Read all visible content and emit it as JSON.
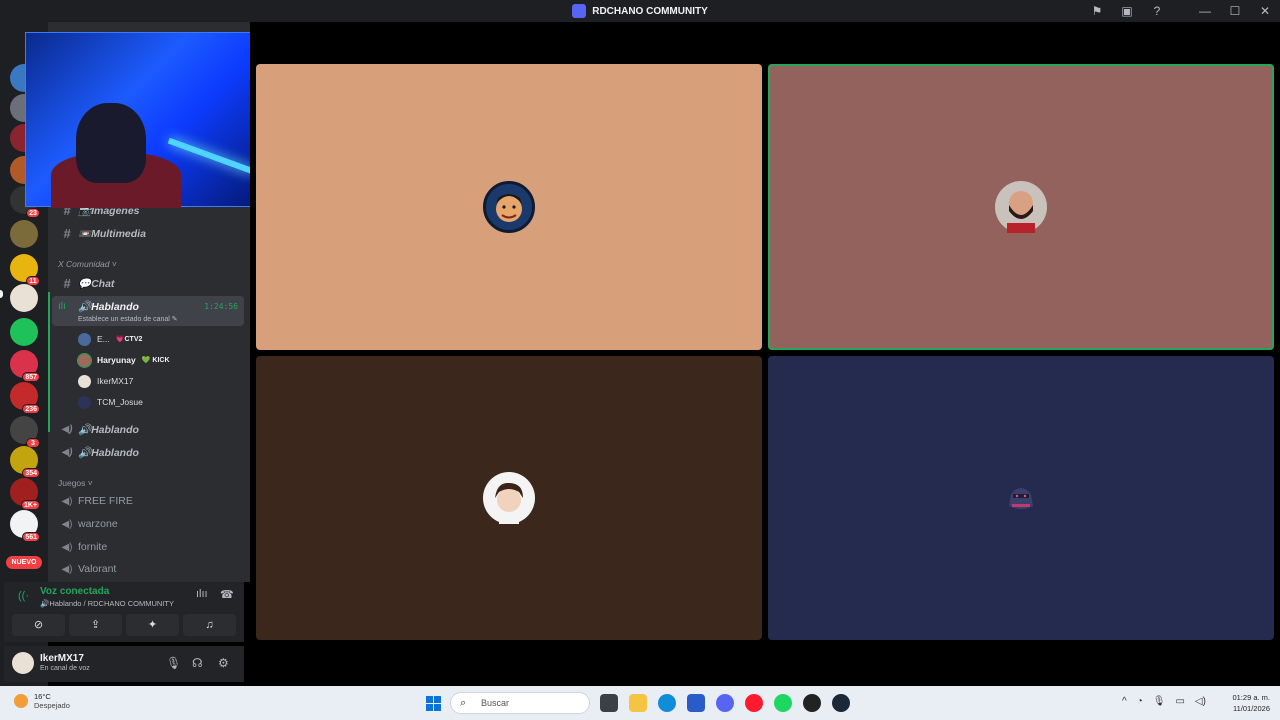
{
  "window": {
    "title": "RDCHANO COMMUNITY",
    "controls": [
      "flag",
      "inbox",
      "help",
      "minimize",
      "maximize",
      "close"
    ]
  },
  "guild_badges": [
    "23",
    "11",
    "857",
    "236",
    "3",
    "354",
    "1K+",
    "561"
  ],
  "guild_new_label": "NUEVO",
  "channels": {
    "images": "📷Imagenes",
    "multimedia": "📼Multimedia",
    "category_community": "X Comunidad ˅",
    "chat": "💬Chat",
    "active_voice": {
      "name": "🔊Hablando",
      "status": "Establece un estado de canal ✎",
      "timer": "1:24:56",
      "members": [
        {
          "name": "E...",
          "tag": "💗CTV2"
        },
        {
          "name": "Haryunay",
          "tag": "💚 KICK"
        },
        {
          "name": "IkerMX17",
          "tag": ""
        },
        {
          "name": "TCM_Josue",
          "tag": ""
        }
      ]
    },
    "voice_2": "🔊Hablando",
    "voice_3": "🔊Hablando",
    "category_games": "Juegos ˅",
    "games": [
      "FREE FIRE",
      "warzone",
      "fornite",
      "Valorant"
    ]
  },
  "voice_panel": {
    "title": "Voz conectada",
    "subtitle": "🔊Hablando / RDCHANO COMMUNITY"
  },
  "user": {
    "name": "IkerMX17",
    "status": "En canal de voz"
  },
  "tiles": [
    {
      "color": "#d8a07a",
      "speaking": false,
      "avatar": "cartoon-face"
    },
    {
      "color": "#93625c",
      "speaking": true,
      "avatar": "bearded-man"
    },
    {
      "color": "#3b271b",
      "speaking": false,
      "avatar": "anime-boy"
    },
    {
      "color": "#252b4f",
      "speaking": false,
      "avatar": "ninja"
    }
  ],
  "taskbar": {
    "temp": "16°C",
    "weather": "Despejado",
    "search_placeholder": "Buscar",
    "time": "01:29 a. m.",
    "date": "11/01/2026"
  }
}
